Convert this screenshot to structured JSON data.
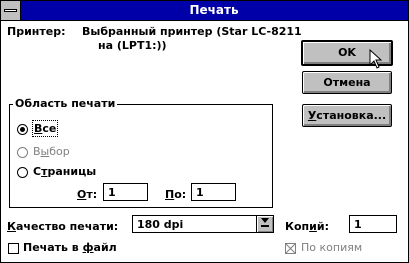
{
  "window": {
    "title": "Печать"
  },
  "printer": {
    "label": "Принтер:",
    "line1": "Выбранный принтер (Star LC-8211",
    "line2": "на  (LPT1:))"
  },
  "buttons": {
    "ok": "OK",
    "cancel": "Отмена",
    "setup_u": "У",
    "setup_rest": "становка..."
  },
  "print_range": {
    "title": "Область печати",
    "all_u": "В",
    "all_rest": "се",
    "selection_u": "ы",
    "selection_pre": "В",
    "selection_rest": "бор",
    "pages_pre": "С",
    "pages_u": "т",
    "pages_rest": "раницы",
    "from_u": "О",
    "from_rest": "т:",
    "from_value": "1",
    "to_u": "П",
    "to_rest": "о:",
    "to_value": "1",
    "selected": "all"
  },
  "quality": {
    "label_u": "К",
    "label_rest": "ачество печати:",
    "value": "180 dpi"
  },
  "copies": {
    "label_pre": "Коп",
    "label_u": "и",
    "label_rest": "й:",
    "value": "1"
  },
  "print_to_file": {
    "pre": "Печать в ",
    "u": "ф",
    "rest": "айл",
    "checked": false
  },
  "collate": {
    "label": "По копиям",
    "checked": true,
    "disabled": true
  },
  "icons": {
    "system_menu": "system-menu-icon",
    "combo_arrow": "underlined-down-arrow",
    "cursor": "arrow-cursor-icon"
  }
}
